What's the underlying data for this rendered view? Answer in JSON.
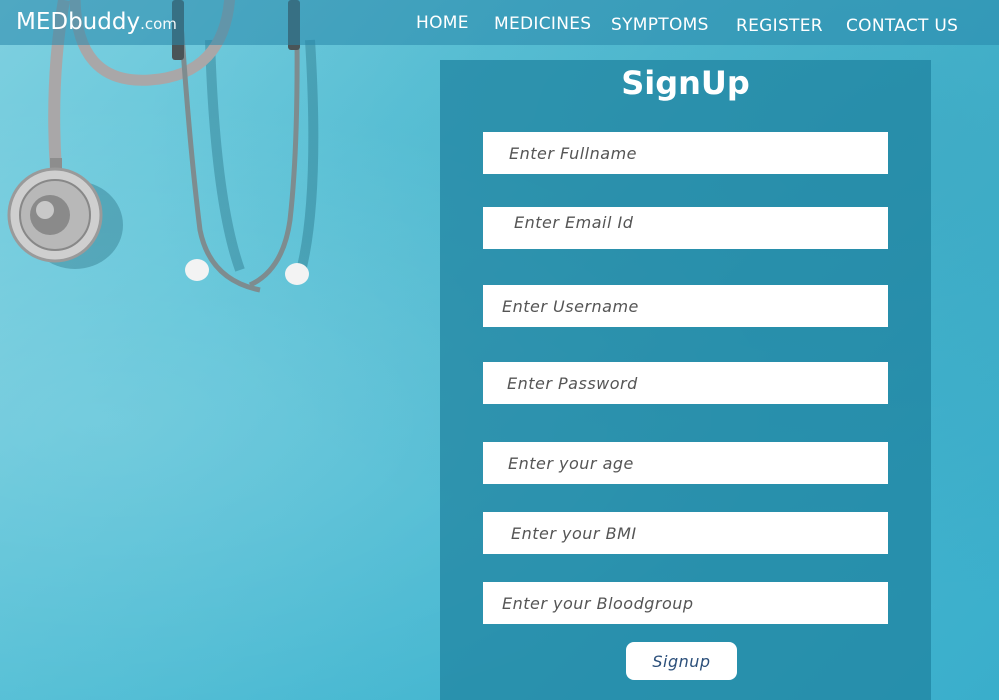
{
  "brand": {
    "name": "MEDbuddy",
    "suffix": ".com"
  },
  "nav": {
    "items": [
      {
        "label": "HOME"
      },
      {
        "label": "MEDICINES"
      },
      {
        "label": "SYMPTOMS"
      },
      {
        "label": "REGISTER"
      },
      {
        "label": "CONTACT US"
      }
    ]
  },
  "form": {
    "title": "SignUp",
    "fields": [
      {
        "placeholder": "Enter Fullname",
        "value": ""
      },
      {
        "placeholder": "Enter Email Id",
        "value": ""
      },
      {
        "placeholder": "Enter Username",
        "value": ""
      },
      {
        "placeholder": "Enter Password",
        "value": ""
      },
      {
        "placeholder": "Enter your age",
        "value": ""
      },
      {
        "placeholder": "Enter your BMI",
        "value": ""
      },
      {
        "placeholder": "Enter your Bloodgroup",
        "value": ""
      }
    ],
    "submit_label": "Signup"
  },
  "colors": {
    "background": "#4fbcd4",
    "navbar": "#2c89aa",
    "panel": "#2a8fac",
    "button_text": "#2b4f7a"
  }
}
